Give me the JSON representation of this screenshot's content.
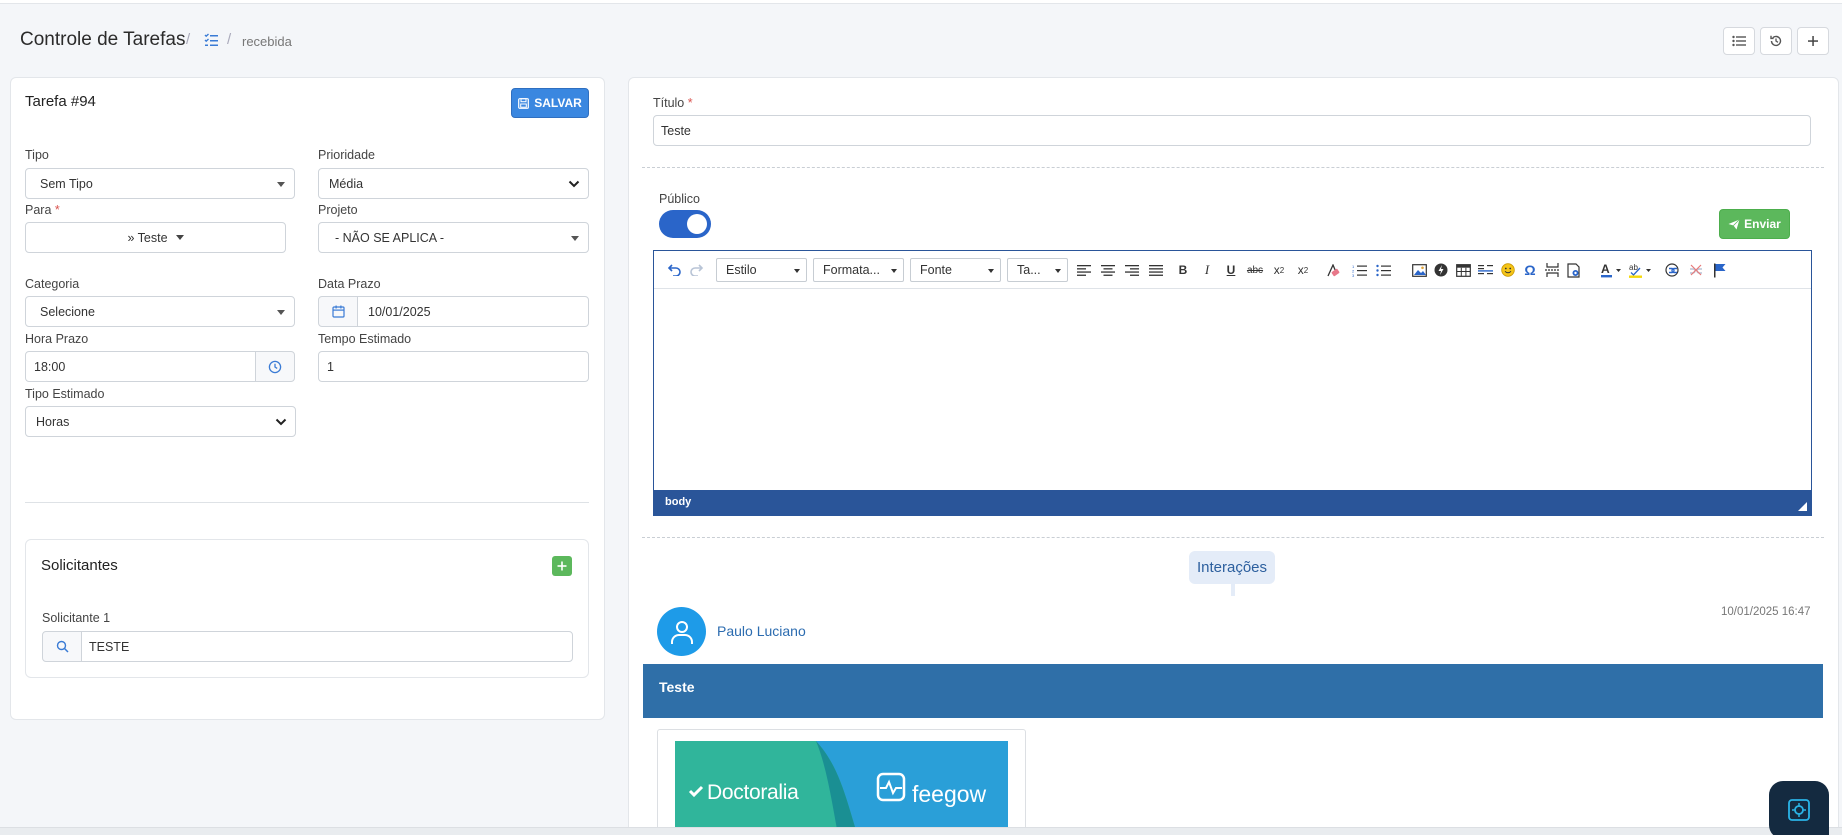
{
  "header": {
    "title": "Controle de Tarefas",
    "separator": "/",
    "breadcrumb_current": "recebida"
  },
  "task": {
    "heading": "Tarefa #94",
    "save_label": "SALVAR",
    "tipo": {
      "label": "Tipo",
      "value": "Sem Tipo"
    },
    "prioridade": {
      "label": "Prioridade",
      "value": "Média"
    },
    "para": {
      "label": "Para",
      "value": "» Teste"
    },
    "projeto": {
      "label": "Projeto",
      "value": "- NÃO SE APLICA -"
    },
    "categoria": {
      "label": "Categoria",
      "value": "Selecione"
    },
    "data_prazo": {
      "label": "Data Prazo",
      "value": "10/01/2025"
    },
    "hora_prazo": {
      "label": "Hora Prazo",
      "value": "18:00"
    },
    "tempo_estimado": {
      "label": "Tempo Estimado",
      "value": "1"
    },
    "tipo_estimado": {
      "label": "Tipo Estimado",
      "value": "Horas"
    },
    "required_mark": "*"
  },
  "solicitantes": {
    "title": "Solicitantes",
    "item_label": "Solicitante 1",
    "item_value": "TESTE"
  },
  "detail": {
    "titulo_label": "Título",
    "titulo_value": "Teste",
    "publico_label": "Público",
    "publico_on": true,
    "enviar_label": "Enviar",
    "editor": {
      "style_drop": "Estilo",
      "format_drop": "Formata...",
      "font_drop": "Fonte",
      "size_drop": "Ta...",
      "status_path": "body"
    },
    "interacoes_label": "Interações"
  },
  "interaction": {
    "author": "Paulo Luciano",
    "timestamp": "10/01/2025 16:47",
    "message": "Teste",
    "image_brand_left": "Doctoralia",
    "image_brand_right": "feegow"
  },
  "colors": {
    "accent": "#3a87e0",
    "editor_bar": "#2a5599",
    "success": "#5cb85c",
    "message_bar": "#2f6fa8"
  }
}
